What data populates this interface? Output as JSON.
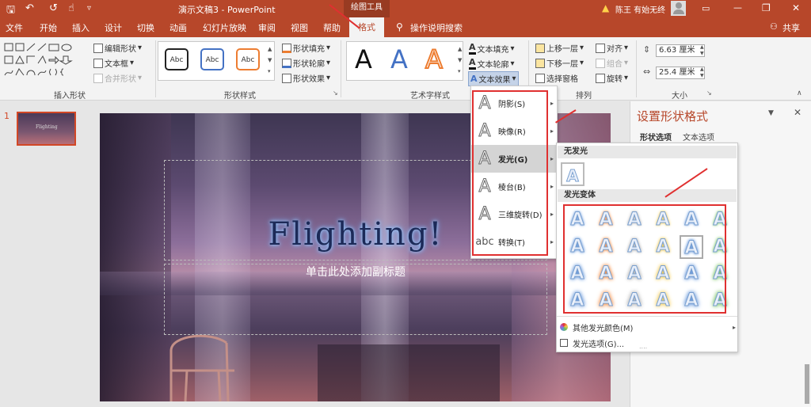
{
  "titlebar": {
    "doc_title": "演示文稿3",
    "separator": " - ",
    "app_name": "PowerPoint",
    "context_tab_group": "绘图工具",
    "warning_text": "陈王 有始无终",
    "qat": {
      "save": "🖫",
      "undo": "↶",
      "redo": "↺",
      "touch": "☝",
      "more": "▿"
    },
    "window": {
      "ribbon_opts": "▭",
      "minimize": "—",
      "restore": "❐",
      "close": "✕"
    }
  },
  "tabs": [
    "文件",
    "开始",
    "插入",
    "设计",
    "切换",
    "动画",
    "幻灯片放映",
    "审阅",
    "视图",
    "帮助"
  ],
  "active_tab": "格式",
  "tell_me": "操作说明搜索",
  "share": "共享",
  "ribbon": {
    "insert_shapes": {
      "label": "插入形状",
      "edit_shape": "编辑形状",
      "text_box": "文本框",
      "merge_shapes": "合并形状"
    },
    "shape_styles": {
      "label": "形状样式",
      "samples": [
        "Abc",
        "Abc",
        "Abc"
      ],
      "fill": "形状填充",
      "outline": "形状轮廓",
      "effects": "形状效果"
    },
    "wordart": {
      "label": "艺术字样式",
      "samples": [
        "A",
        "A",
        "A"
      ],
      "text_fill": "文本填充",
      "text_outline": "文本轮廓",
      "text_effects": "文本效果"
    },
    "arrange": {
      "label": "排列",
      "bring_forward": "上移一层",
      "send_backward": "下移一层",
      "selection_pane": "选择窗格",
      "align": "对齐",
      "group": "组合",
      "rotate": "旋转"
    },
    "size": {
      "label": "大小",
      "height": "6.63 厘米",
      "width": "25.4 厘米"
    }
  },
  "slides_panel": {
    "slide_number": "1",
    "thumb_text": "Flighting"
  },
  "slide": {
    "title": "Flighting!",
    "subtitle": "单击此处添加副标题"
  },
  "text_effects_menu": [
    {
      "label": "阴影(S)",
      "icon": "shadow-icon"
    },
    {
      "label": "映像(R)",
      "icon": "reflection-icon"
    },
    {
      "label": "发光(G)",
      "icon": "glow-icon"
    },
    {
      "label": "棱台(B)",
      "icon": "bevel-icon"
    },
    {
      "label": "三维旋转(D)",
      "icon": "3d-rotation-icon"
    },
    {
      "label": "转换(T)",
      "icon": "transform-icon"
    }
  ],
  "glow_gallery": {
    "no_glow_header": "无发光",
    "variants_header": "发光变体",
    "more_colors": "其他发光颜色(M)",
    "glow_options": "发光选项(G)...",
    "grip": "....",
    "colors": [
      "#5b8fd6",
      "#f0883e",
      "#b0b0b0",
      "#f2c94c",
      "#5b8fd6",
      "#6fbf5a"
    ]
  },
  "format_pane": {
    "title": "设置形状格式",
    "tab_shape": "形状选项",
    "tab_text": "文本选项"
  }
}
